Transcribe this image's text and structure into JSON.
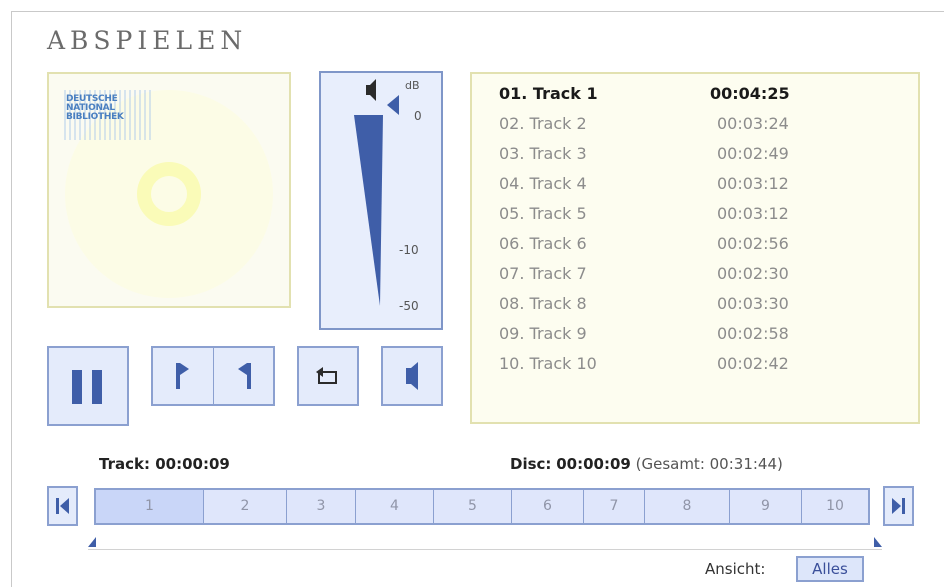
{
  "title": "ABSPIELEN",
  "cover": {
    "logo_lines": [
      "DEUTSCHE",
      "NATIONAL",
      "BIBLIOTHEK"
    ]
  },
  "meter": {
    "unit": "dB",
    "labels": [
      "0",
      "-10",
      "-50"
    ],
    "speaker_icon": "speaker-icon",
    "level_marker_icon": "triangle-left-icon"
  },
  "controls": {
    "pause_icon": "pause-icon",
    "prev_icon": "step-back-icon",
    "next_icon": "step-forward-icon",
    "repeat_icon": "repeat-icon",
    "volume_icon": "speaker-icon"
  },
  "tracks": [
    {
      "name": "01. Track 1",
      "duration": "00:04:25",
      "active": true
    },
    {
      "name": "02. Track 2",
      "duration": "00:03:24",
      "active": false
    },
    {
      "name": "03. Track 3",
      "duration": "00:02:49",
      "active": false
    },
    {
      "name": "04. Track 4",
      "duration": "00:03:12",
      "active": false
    },
    {
      "name": "05. Track 5",
      "duration": "00:03:12",
      "active": false
    },
    {
      "name": "06. Track 6",
      "duration": "00:02:56",
      "active": false
    },
    {
      "name": "07. Track 7",
      "duration": "00:02:30",
      "active": false
    },
    {
      "name": "08. Track 8",
      "duration": "00:03:30",
      "active": false
    },
    {
      "name": "09. Track 9",
      "duration": "00:02:58",
      "active": false
    },
    {
      "name": "10. Track 10",
      "duration": "00:02:42",
      "active": false
    }
  ],
  "status": {
    "track_label": "Track:",
    "track_time": "00:00:09",
    "disc_label": "Disc:",
    "disc_time": "00:00:09",
    "total_text": "(Gesamt: 00:31:44)"
  },
  "timeline": {
    "segments": [
      "1",
      "2",
      "3",
      "4",
      "5",
      "6",
      "7",
      "8",
      "9",
      "10"
    ],
    "first_icon": "skip-to-start-icon",
    "last_icon": "skip-to-end-icon"
  },
  "view": {
    "label": "Ansicht:",
    "button": "Alles"
  },
  "colors": {
    "accent_blue": "#3f5ea8",
    "button_bg": "#e4ebfb",
    "button_border": "#8ba0d0",
    "panel_bg": "#fdfdf0",
    "panel_border": "#e2e1b0"
  }
}
